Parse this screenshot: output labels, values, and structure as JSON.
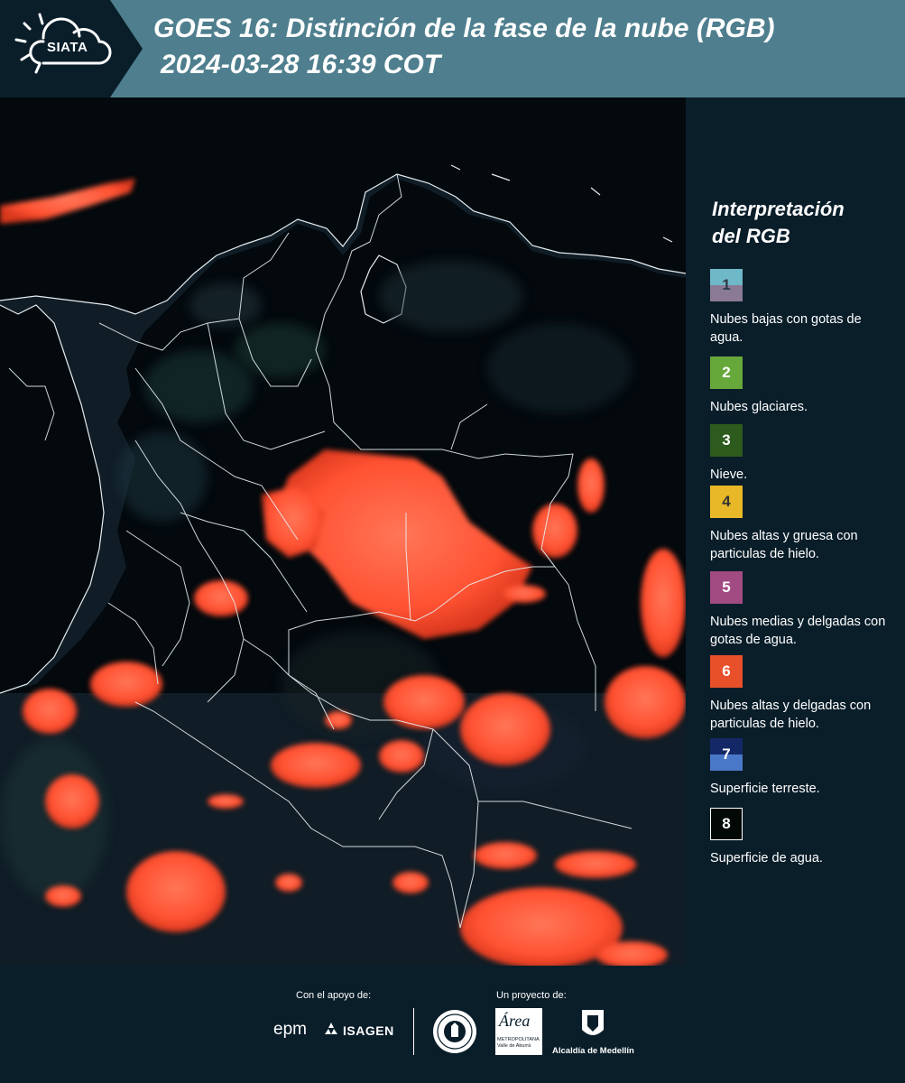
{
  "header": {
    "logo_text": "SIATA",
    "title_line1": "GOES 16: Distinción de la fase de la nube (RGB)",
    "title_line2": "2024-03-28 16:39 COT",
    "band_color": "#4f7f8e"
  },
  "legend": {
    "heading_line1": "Interpretación",
    "heading_line2": "del RGB",
    "items": [
      {
        "number": "1",
        "label": "Nubes bajas con gotas de agua.",
        "color_top": "#6fb8c8",
        "color_bottom": "#8a7a96",
        "num_color": "#2e3a48"
      },
      {
        "number": "2",
        "label": "Nubes glaciares.",
        "color_top": "#66a83a",
        "color_bottom": "#66a83a",
        "num_color": "#ffffff"
      },
      {
        "number": "3",
        "label": "Nieve.",
        "color_top": "#2d5b1d",
        "color_bottom": "#2d5b1d",
        "num_color": "#ffffff"
      },
      {
        "number": "4",
        "label": "Nubes altas y gruesa con particulas de hielo.",
        "color_top": "#e8b828",
        "color_bottom": "#e8b828",
        "num_color": "#333333"
      },
      {
        "number": "5",
        "label": "Nubes medias y delgadas con gotas de agua.",
        "color_top": "#a24a82",
        "color_bottom": "#a24a82",
        "num_color": "#ffffff"
      },
      {
        "number": "6",
        "label": "Nubes altas y delgadas con particulas de hielo.",
        "color_top": "#e8502a",
        "color_bottom": "#e8502a",
        "num_color": "#ffffff"
      },
      {
        "number": "7",
        "label": "Superficie terreste.",
        "color_top": "#142868",
        "color_bottom": "#4a78c8",
        "num_color": "#ffffff"
      },
      {
        "number": "8",
        "label": "Superficie de agua.",
        "color_top": "#020806",
        "color_bottom": "#020806",
        "num_color": "#ffffff"
      }
    ]
  },
  "footer": {
    "support_label": "Con el apoyo de:",
    "project_label": "Un proyecto de:",
    "epm_text": "epm",
    "isagen_text": "ISAGEN",
    "area_text": "Área",
    "area_sub_line1": "METROPOLITANA",
    "area_sub_line2": "Valle de Aburrá",
    "alcaldia_text": "Alcaldía de Medellín"
  },
  "map": {
    "cloud_color": "#ff5a38",
    "land_color": "#12202a",
    "water_color": "#03090d",
    "border_color": "#e6eef2"
  }
}
